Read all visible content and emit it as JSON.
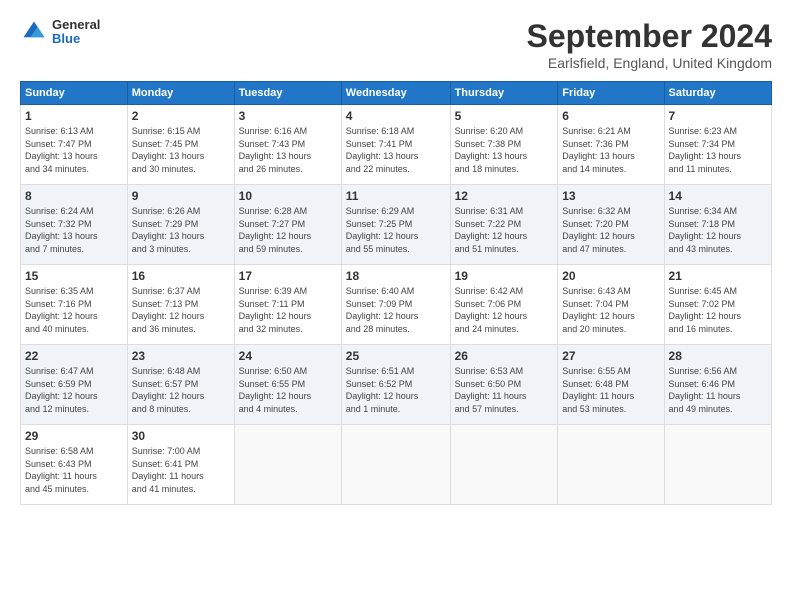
{
  "header": {
    "logo_general": "General",
    "logo_blue": "Blue",
    "month_title": "September 2024",
    "location": "Earlsfield, England, United Kingdom"
  },
  "days_of_week": [
    "Sunday",
    "Monday",
    "Tuesday",
    "Wednesday",
    "Thursday",
    "Friday",
    "Saturday"
  ],
  "weeks": [
    [
      {
        "day": "1",
        "info": "Sunrise: 6:13 AM\nSunset: 7:47 PM\nDaylight: 13 hours\nand 34 minutes."
      },
      {
        "day": "2",
        "info": "Sunrise: 6:15 AM\nSunset: 7:45 PM\nDaylight: 13 hours\nand 30 minutes."
      },
      {
        "day": "3",
        "info": "Sunrise: 6:16 AM\nSunset: 7:43 PM\nDaylight: 13 hours\nand 26 minutes."
      },
      {
        "day": "4",
        "info": "Sunrise: 6:18 AM\nSunset: 7:41 PM\nDaylight: 13 hours\nand 22 minutes."
      },
      {
        "day": "5",
        "info": "Sunrise: 6:20 AM\nSunset: 7:38 PM\nDaylight: 13 hours\nand 18 minutes."
      },
      {
        "day": "6",
        "info": "Sunrise: 6:21 AM\nSunset: 7:36 PM\nDaylight: 13 hours\nand 14 minutes."
      },
      {
        "day": "7",
        "info": "Sunrise: 6:23 AM\nSunset: 7:34 PM\nDaylight: 13 hours\nand 11 minutes."
      }
    ],
    [
      {
        "day": "8",
        "info": "Sunrise: 6:24 AM\nSunset: 7:32 PM\nDaylight: 13 hours\nand 7 minutes."
      },
      {
        "day": "9",
        "info": "Sunrise: 6:26 AM\nSunset: 7:29 PM\nDaylight: 13 hours\nand 3 minutes."
      },
      {
        "day": "10",
        "info": "Sunrise: 6:28 AM\nSunset: 7:27 PM\nDaylight: 12 hours\nand 59 minutes."
      },
      {
        "day": "11",
        "info": "Sunrise: 6:29 AM\nSunset: 7:25 PM\nDaylight: 12 hours\nand 55 minutes."
      },
      {
        "day": "12",
        "info": "Sunrise: 6:31 AM\nSunset: 7:22 PM\nDaylight: 12 hours\nand 51 minutes."
      },
      {
        "day": "13",
        "info": "Sunrise: 6:32 AM\nSunset: 7:20 PM\nDaylight: 12 hours\nand 47 minutes."
      },
      {
        "day": "14",
        "info": "Sunrise: 6:34 AM\nSunset: 7:18 PM\nDaylight: 12 hours\nand 43 minutes."
      }
    ],
    [
      {
        "day": "15",
        "info": "Sunrise: 6:35 AM\nSunset: 7:16 PM\nDaylight: 12 hours\nand 40 minutes."
      },
      {
        "day": "16",
        "info": "Sunrise: 6:37 AM\nSunset: 7:13 PM\nDaylight: 12 hours\nand 36 minutes."
      },
      {
        "day": "17",
        "info": "Sunrise: 6:39 AM\nSunset: 7:11 PM\nDaylight: 12 hours\nand 32 minutes."
      },
      {
        "day": "18",
        "info": "Sunrise: 6:40 AM\nSunset: 7:09 PM\nDaylight: 12 hours\nand 28 minutes."
      },
      {
        "day": "19",
        "info": "Sunrise: 6:42 AM\nSunset: 7:06 PM\nDaylight: 12 hours\nand 24 minutes."
      },
      {
        "day": "20",
        "info": "Sunrise: 6:43 AM\nSunset: 7:04 PM\nDaylight: 12 hours\nand 20 minutes."
      },
      {
        "day": "21",
        "info": "Sunrise: 6:45 AM\nSunset: 7:02 PM\nDaylight: 12 hours\nand 16 minutes."
      }
    ],
    [
      {
        "day": "22",
        "info": "Sunrise: 6:47 AM\nSunset: 6:59 PM\nDaylight: 12 hours\nand 12 minutes."
      },
      {
        "day": "23",
        "info": "Sunrise: 6:48 AM\nSunset: 6:57 PM\nDaylight: 12 hours\nand 8 minutes."
      },
      {
        "day": "24",
        "info": "Sunrise: 6:50 AM\nSunset: 6:55 PM\nDaylight: 12 hours\nand 4 minutes."
      },
      {
        "day": "25",
        "info": "Sunrise: 6:51 AM\nSunset: 6:52 PM\nDaylight: 12 hours\nand 1 minute."
      },
      {
        "day": "26",
        "info": "Sunrise: 6:53 AM\nSunset: 6:50 PM\nDaylight: 11 hours\nand 57 minutes."
      },
      {
        "day": "27",
        "info": "Sunrise: 6:55 AM\nSunset: 6:48 PM\nDaylight: 11 hours\nand 53 minutes."
      },
      {
        "day": "28",
        "info": "Sunrise: 6:56 AM\nSunset: 6:46 PM\nDaylight: 11 hours\nand 49 minutes."
      }
    ],
    [
      {
        "day": "29",
        "info": "Sunrise: 6:58 AM\nSunset: 6:43 PM\nDaylight: 11 hours\nand 45 minutes."
      },
      {
        "day": "30",
        "info": "Sunrise: 7:00 AM\nSunset: 6:41 PM\nDaylight: 11 hours\nand 41 minutes."
      },
      {
        "day": "",
        "info": ""
      },
      {
        "day": "",
        "info": ""
      },
      {
        "day": "",
        "info": ""
      },
      {
        "day": "",
        "info": ""
      },
      {
        "day": "",
        "info": ""
      }
    ]
  ]
}
